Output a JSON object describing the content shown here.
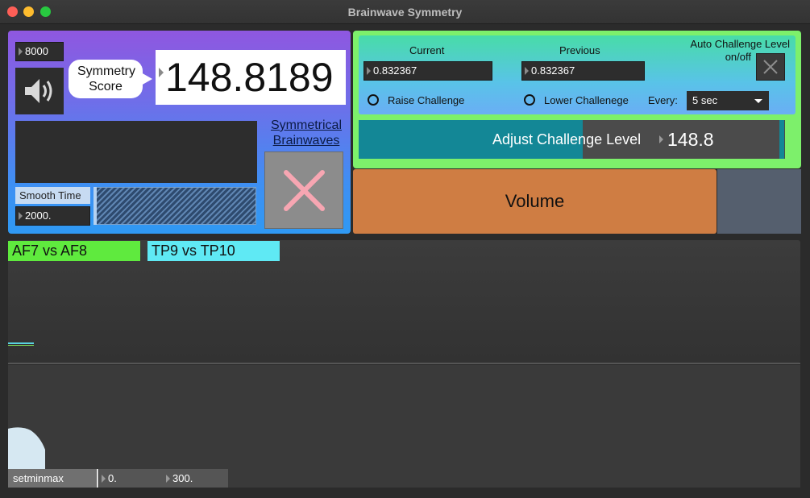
{
  "window": {
    "title": "Brainwave Symmetry"
  },
  "left_panel": {
    "gain_value": "8000",
    "speaker_icon": "speaker-icon",
    "symmetry_label": "Symmetry Score",
    "symmetry_score": "148.8189",
    "smooth_time_label": "Smooth Time",
    "smooth_time_value": "2000.",
    "symmetrical_link": "Symmetrical Brainwaves"
  },
  "right_panel": {
    "current_label": "Current",
    "current_value": "0.832367",
    "previous_label": "Previous",
    "previous_value": "0.832367",
    "auto_challenge_label_1": "Auto Challenge Level",
    "auto_challenge_label_2": "on/off",
    "raise_label": "Raise Challenge",
    "lower_label": "Lower Challenege",
    "every_label": "Every:",
    "every_value": "5 sec",
    "adjust_label": "Adjust Challenge Level",
    "adjust_value": "148.8",
    "volume_label": "Volume"
  },
  "scope": {
    "tab_1": "AF7 vs AF8",
    "tab_2": "TP9 vs TP10"
  },
  "histogram": {
    "message": "setminmax",
    "min_value": "0.",
    "max_value": "300."
  },
  "colors": {
    "tab_1": "#5fea3e",
    "tab_2": "#5fe9f4",
    "volume": "#cf7d43",
    "adjust_fill": "#138796"
  }
}
